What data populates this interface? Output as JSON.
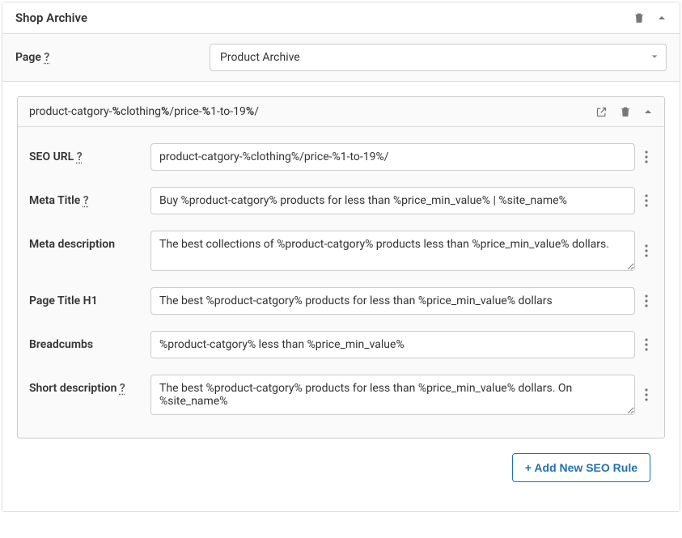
{
  "panel": {
    "title": "Shop Archive"
  },
  "page_selector": {
    "label": "Page",
    "help": "?",
    "selected": "Product Archive"
  },
  "rule": {
    "slug_parts": [
      "product-catgory-",
      "%",
      "clothing",
      "%",
      "/price-",
      "%",
      "1-to-19",
      "%",
      "/"
    ],
    "fields": {
      "seo_url": {
        "label": "SEO URL",
        "help": "?",
        "value": "product-catgory-%clothing%/price-%1-to-19%/"
      },
      "meta_title": {
        "label": "Meta Title",
        "help": "?",
        "value": "Buy %product-catgory% products for less than %price_min_value% | %site_name%"
      },
      "meta_description": {
        "label": "Meta description",
        "value": "The best collections of %product-catgory% products less than %price_min_value% dollars."
      },
      "page_title_h1": {
        "label": "Page Title H1",
        "value": "The best %product-catgory% products for less than %price_min_value% dollars"
      },
      "breadcrumbs": {
        "label": "Breadcumbs",
        "value": "%product-catgory% less than %price_min_value%"
      },
      "short_description": {
        "label": "Short description",
        "help": "?",
        "value": "The best %product-catgory% products for less than %price_min_value% dollars. On %site_name%"
      }
    }
  },
  "footer": {
    "add_button": "+ Add New SEO Rule"
  }
}
